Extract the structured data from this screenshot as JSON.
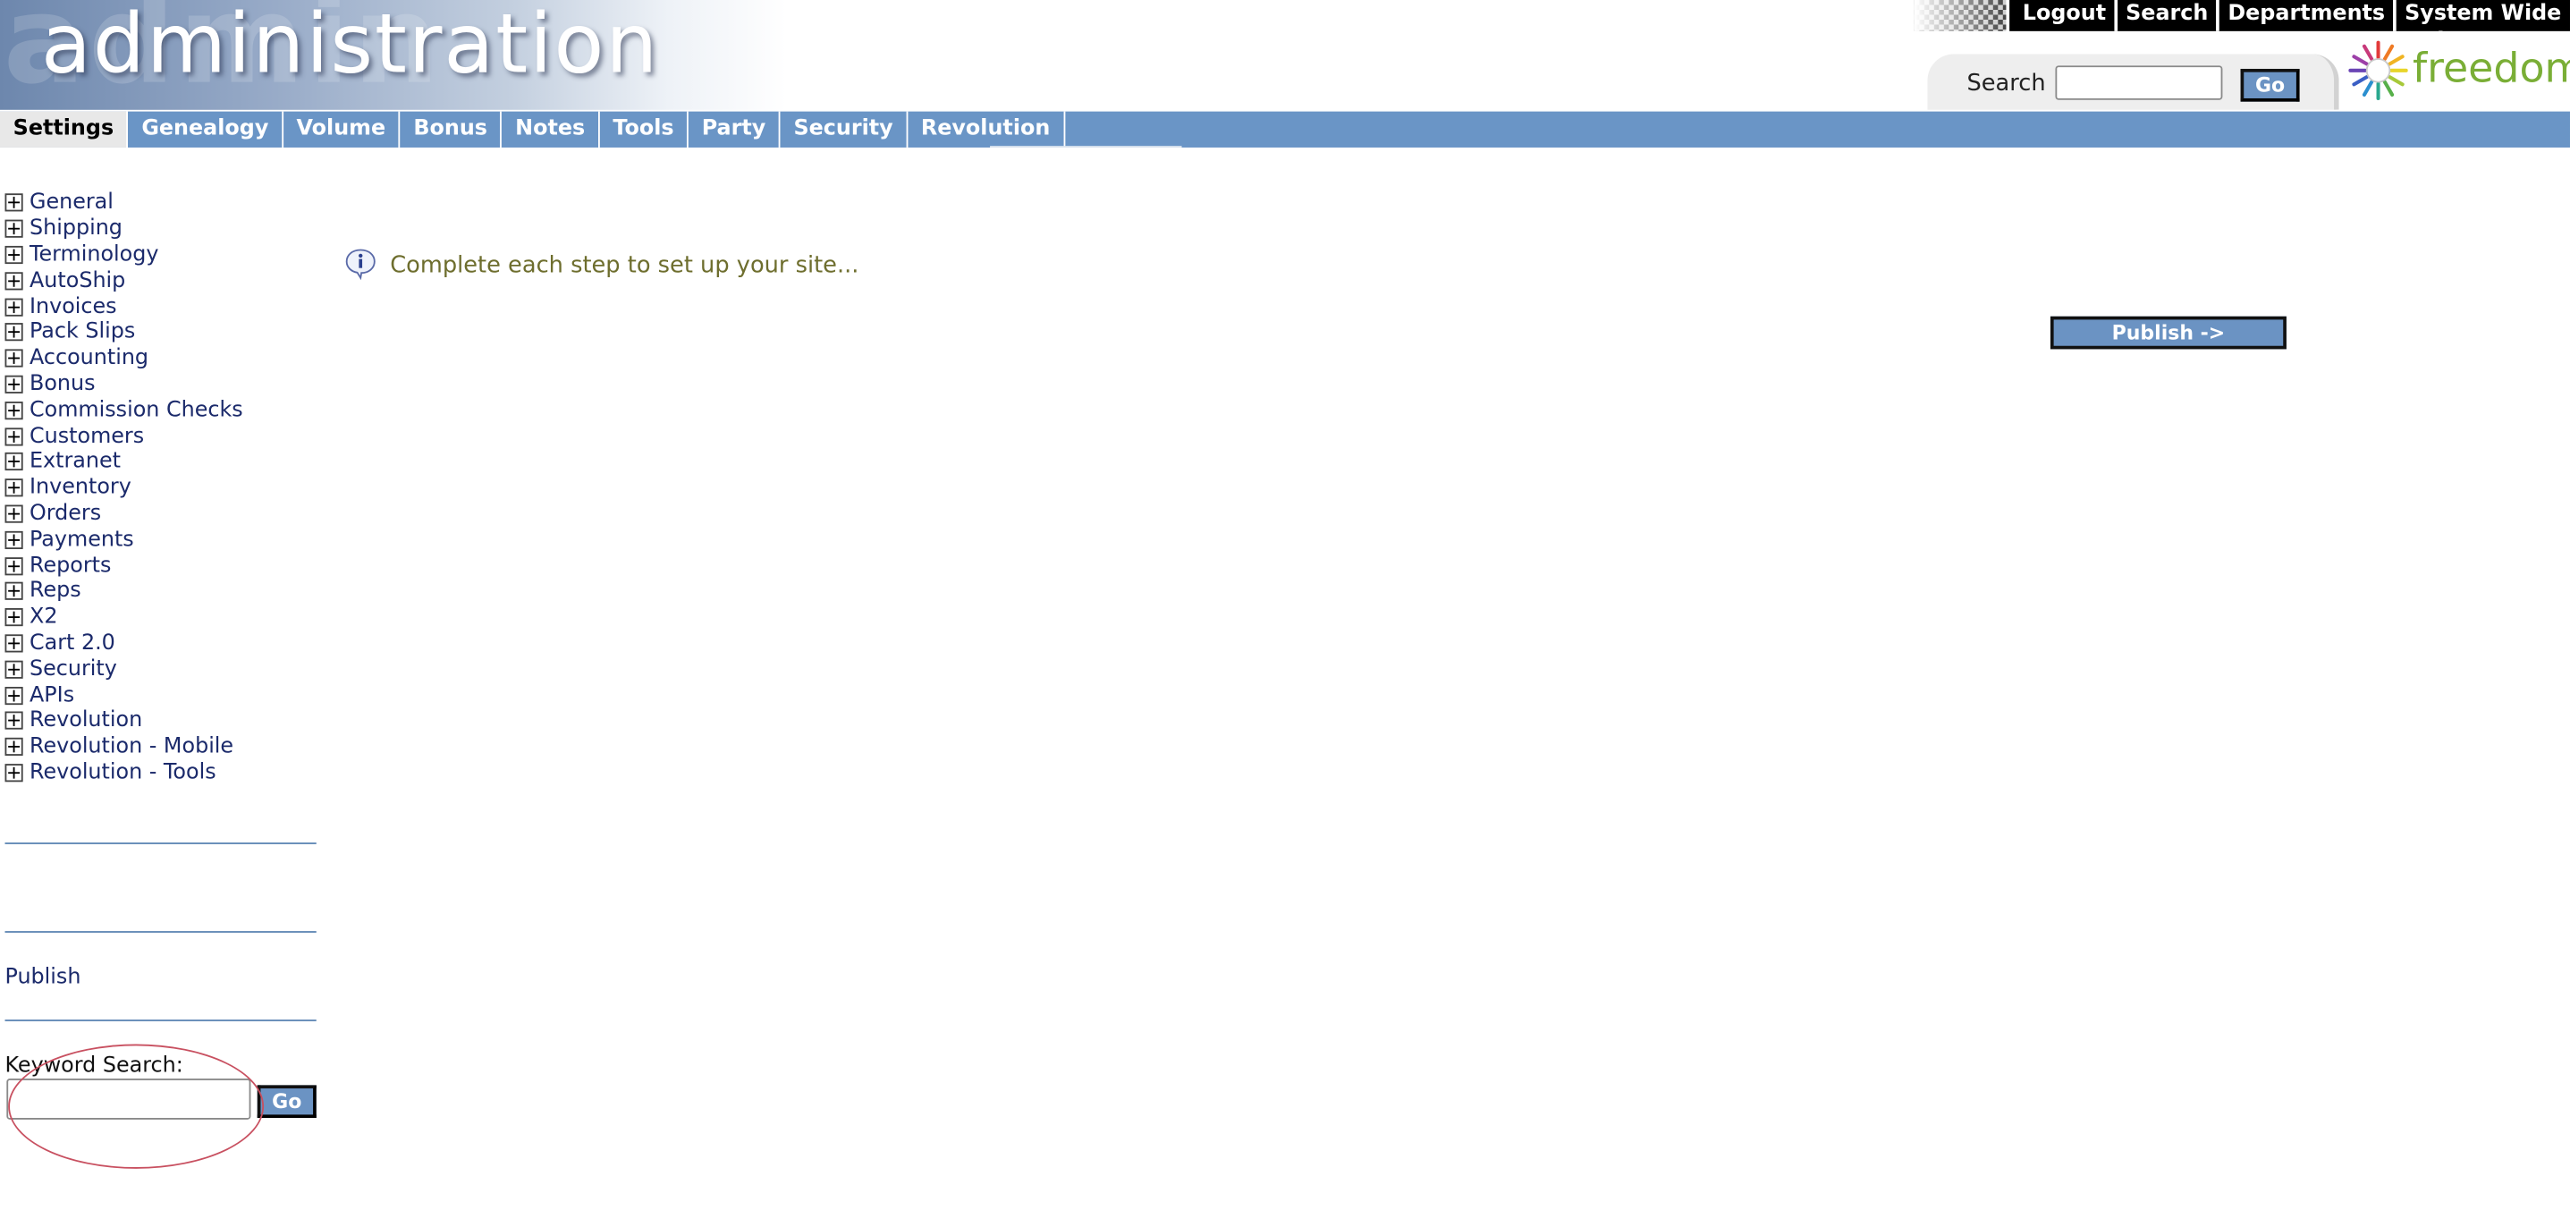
{
  "header": {
    "banner_title": "administration",
    "top_links": [
      "Logout",
      "Search",
      "Departments",
      "System Wide Help"
    ],
    "search_label": "Search",
    "search_button": "Go",
    "logo_text": "freedom"
  },
  "nav": {
    "tabs": [
      {
        "label": "Settings",
        "active": true
      },
      {
        "label": "Genealogy",
        "active": false
      },
      {
        "label": "Volume",
        "active": false
      },
      {
        "label": "Bonus",
        "active": false
      },
      {
        "label": "Notes",
        "active": false
      },
      {
        "label": "Tools",
        "active": false
      },
      {
        "label": "Party",
        "active": false
      },
      {
        "label": "Security",
        "active": false
      },
      {
        "label": "Revolution",
        "active": false
      }
    ]
  },
  "sidebar": {
    "items": [
      "General",
      "Shipping",
      "Terminology",
      "AutoShip",
      "Invoices",
      "Pack Slips",
      "Accounting",
      "Bonus",
      "Commission Checks",
      "Customers",
      "Extranet",
      "Inventory",
      "Orders",
      "Payments",
      "Reports",
      "Reps",
      "X2",
      "Cart 2.0",
      "Security",
      "APIs",
      "Revolution",
      "Revolution - Mobile",
      "Revolution - Tools"
    ],
    "publish_link": "Publish",
    "keyword_label": "Keyword Search:",
    "keyword_button": "Go"
  },
  "main": {
    "info_message": "Complete each step to set up your site...",
    "publish_button": "Publish ->"
  },
  "colors": {
    "nav_blue": "#6a95c6",
    "link_navy": "#1b2a6b",
    "info_olive": "#6e6e2e",
    "logo_green": "#7aae36",
    "annotation_red": "#c85060"
  }
}
